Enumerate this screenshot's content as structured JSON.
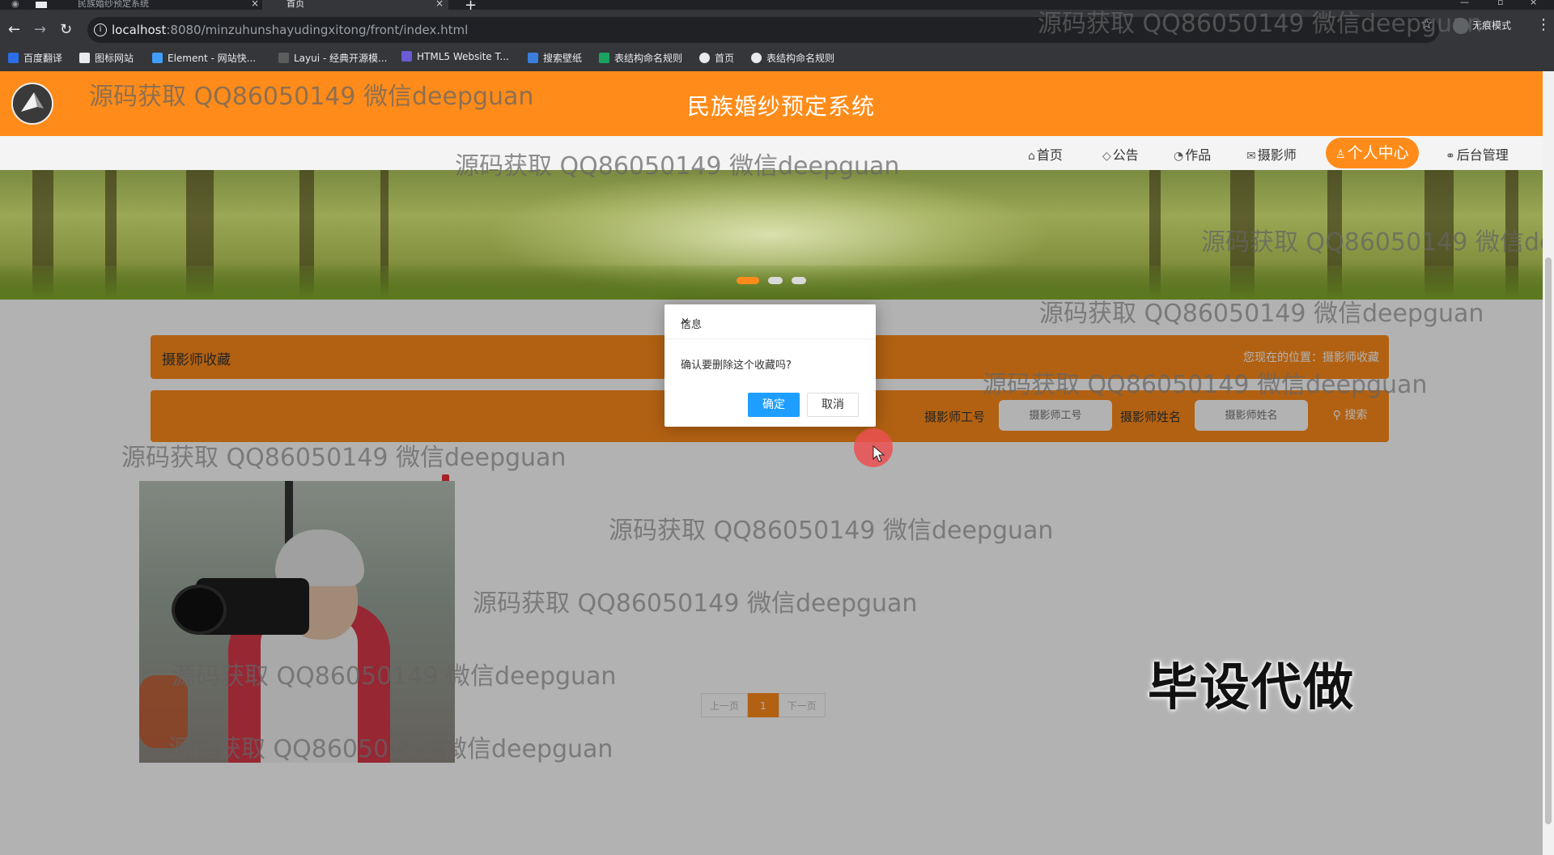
{
  "browser": {
    "tabs": [
      {
        "title": "民族婚纱预定系统"
      },
      {
        "title": "首页"
      }
    ],
    "url_host": "localhost",
    "url_rest": ":8080/minzuhunshayudingxitong/front/index.html",
    "incognito_label": "无痕模式",
    "bookmarks": [
      "百度翻译",
      "图标网站",
      "Element - 网站快...",
      "Layui - 经典开源模...",
      "HTML5 Website T...",
      "搜索壁纸",
      "表结构命名规则",
      "首页",
      "表结构命名规则"
    ]
  },
  "site": {
    "title": "民族婚纱预定系统"
  },
  "nav": {
    "home": "首页",
    "notice": "公告",
    "works": "作品",
    "photographer": "摄影师",
    "personal_center": "个人中心",
    "admin": "后台管理"
  },
  "banner": {
    "active_slide": 1,
    "slide_count": 3
  },
  "section": {
    "title": "摄影师收藏",
    "location": "您现在的位置：摄影师收藏"
  },
  "search": {
    "label_id": "摄影师工号",
    "placeholder_id": "摄影师工号",
    "label_name": "摄影师姓名",
    "placeholder_name": "摄影师姓名",
    "button": "搜索"
  },
  "pagination": {
    "prev": "上一页",
    "current": "1",
    "next": "下一页"
  },
  "dialog": {
    "title": "信息",
    "message": "确认要删除这个收藏吗?",
    "ok": "确定",
    "cancel": "取消"
  },
  "watermarks": {
    "text": "源码获取 QQ86050149 微信deepguan",
    "overlay_text": "毕设代做"
  },
  "colors": {
    "accent": "#ff8c1a",
    "dialog_primary": "#1e9fff"
  }
}
